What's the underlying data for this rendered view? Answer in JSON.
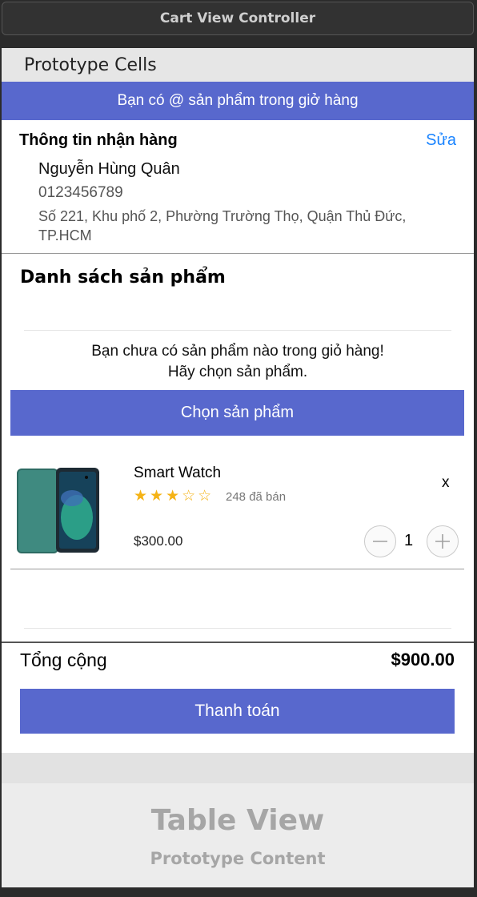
{
  "window": {
    "title": "Cart View Controller"
  },
  "prototype": {
    "header": "Prototype Cells"
  },
  "cart_banner": "Bạn có @ sản phẩm trong giở hàng",
  "receiver": {
    "title": "Thông tin nhận hàng",
    "edit_label": "Sửa",
    "name": "Nguyễn Hùng Quân",
    "phone": "0123456789",
    "address": "Số 221, Khu phố 2, Phường Trường Thọ, Quận Thủ Đức, TP.HCM"
  },
  "product_list": {
    "title": "Danh sách sản phẩm",
    "empty_message_line1": "Bạn chưa có sản phẩm nào trong giỏ hàng!",
    "empty_message_line2": "Hãy chọn sản phẩm.",
    "choose_button": "Chọn sản phẩm"
  },
  "product": {
    "name": "Smart Watch",
    "rating": 3,
    "rating_max": 5,
    "stars_text": "★★★☆☆",
    "sold": "248 đã bán",
    "price": "$300.00",
    "quantity": "1",
    "remove_label": "x",
    "minus_icon": "minus-circle-icon",
    "plus_icon": "plus-circle-icon"
  },
  "summary": {
    "total_label": "Tổng cộng",
    "total_value": "$900.00",
    "checkout_button": "Thanh toán"
  },
  "table_view": {
    "title": "Table View",
    "subtitle": "Prototype Content"
  },
  "colors": {
    "accent": "#5868CD",
    "link": "#1A84FF",
    "star": "#F5B315"
  }
}
